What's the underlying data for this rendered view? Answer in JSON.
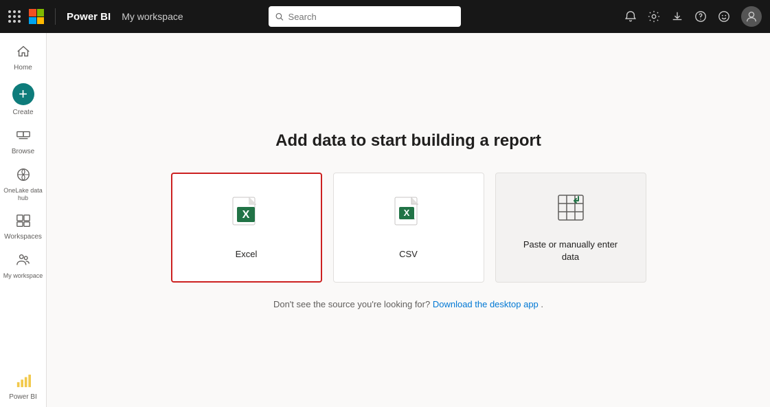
{
  "topnav": {
    "product": "Power BI",
    "workspace": "My workspace",
    "search_placeholder": "Search",
    "icons": {
      "notifications": "🔔",
      "settings": "⚙",
      "download": "⬇",
      "help": "?",
      "smiley": "☺"
    }
  },
  "sidebar": {
    "items": [
      {
        "id": "home",
        "label": "Home",
        "icon": "🏠",
        "active": false
      },
      {
        "id": "create",
        "label": "Create",
        "icon": "+",
        "active": false
      },
      {
        "id": "browse",
        "label": "Browse",
        "icon": "📁",
        "active": false
      },
      {
        "id": "onelake",
        "label": "OneLake data hub",
        "icon": "🌐",
        "active": false
      },
      {
        "id": "workspaces",
        "label": "Workspaces",
        "icon": "🖥",
        "active": false
      },
      {
        "id": "my-workspace",
        "label": "My workspace",
        "icon": "👥",
        "active": false
      },
      {
        "id": "powerbi",
        "label": "Power BI",
        "icon": "📊",
        "active": false
      }
    ]
  },
  "main": {
    "title": "Add data to start building a report",
    "cards": [
      {
        "id": "excel",
        "label": "Excel",
        "selected": true
      },
      {
        "id": "csv",
        "label": "CSV",
        "selected": false
      },
      {
        "id": "paste",
        "label": "Paste or manually enter\ndata",
        "selected": false,
        "muted": true
      }
    ],
    "hint_text": "Don't see the source you're looking for?",
    "hint_link": "Download the desktop app",
    "hint_suffix": "."
  }
}
